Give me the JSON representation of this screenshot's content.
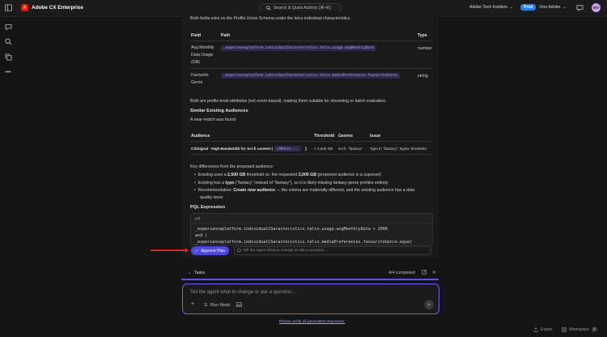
{
  "header": {
    "logo_letter": "A",
    "app_title": "Adobe CX Enterprise",
    "search_placeholder": "Search & Quick Actions (⌘+K)",
    "org_name": "Adobe Tech Insiders",
    "env_badge": "Prod",
    "sandbox_name": "One Adobe",
    "avatar_initials": "WV"
  },
  "content": {
    "intro": "Both fields exist on the Profile Union Schema under the telco individual characteristics.",
    "field_table": {
      "headers": [
        "Field",
        "Path",
        "Type"
      ],
      "rows": [
        {
          "field_lines": [
            "Avg Monthly",
            "Data Usage",
            "(GB)"
          ],
          "path": "_experienceplatform.individualCharacteristics.telco.usage.avgMonthlyData",
          "type": "number"
        },
        {
          "field_lines": [
            "Favourite",
            "Genre"
          ],
          "path": "_experienceplatform.individualCharacteristics.telco.mediaPreferences.favouriteGenre",
          "type": "string"
        }
      ]
    },
    "profile_note": "Both are profile-level attributes (not event-based), making them suitable for streaming or batch evaluation.",
    "similar_heading": "Similar Existing Audiences",
    "near_match": "A near-match was found:",
    "audience_table": {
      "headers": [
        "Audience",
        "Threshold",
        "Genres",
        "Issue"
      ],
      "row": {
        "audience": "CitiSignal - High-Bandwidth for Sci-fi content (",
        "audience_id": "c98de1e-...",
        "audience_close": ")",
        "threshold": "> 2,500 GB",
        "genres": "sci-fi, \"fantacy\"",
        "issue": "Typo in \"fantacy\"; higher threshold"
      }
    },
    "key_diff_heading": "Key differences from the proposed audience:",
    "bullets": {
      "b1_pre": "Existing uses a ",
      "b1_bold1": "2,500 GB",
      "b1_mid": " threshold vs. the requested ",
      "b1_bold2": "2,000 GB",
      "b1_post": " (proposed audience is a superset)",
      "b2_pre": "Existing has a ",
      "b2_bold": "typo",
      "b2_post": " (\"fantacy\" instead of \"fantasy\"), so it is likely missing fantasy-genre profiles entirely",
      "b3_pre": "Recommendation: ",
      "b3_bold": "Create new audience",
      "b3_post": " — the criteria are materially different, and the existing audience has a data",
      "b3_cont": "quality issue"
    },
    "pql_heading": "PQL Expression",
    "pql_lang": "pql",
    "pql_lines": [
      "_experienceplatform.individualCharacteristics.telco.usage.avgMonthlyData > 2000",
      "and (",
      "  _experienceplatform.individualCharacteristics.telco.mediaPreferences.favouriteGenre.equal"
    ],
    "approve_label": "Approve Plan",
    "inline_placeholder": "Tell the agent what to change or ask a question..."
  },
  "tasks": {
    "label": "Tasks",
    "status": "4/4 completed"
  },
  "composer": {
    "placeholder": "Tell the agent what to change or ask a question...",
    "plan_mode": "Plan Mode"
  },
  "disclaimer": "Please verify all generated responses.",
  "footer": {
    "export": "Export",
    "workspace": "Workspace",
    "workspace_count": "0"
  },
  "colors": {
    "accent": "#4e46e5",
    "brand": "#eb1000",
    "prod_badge": "#2680eb",
    "annotation_arrow": "#e1251b"
  }
}
